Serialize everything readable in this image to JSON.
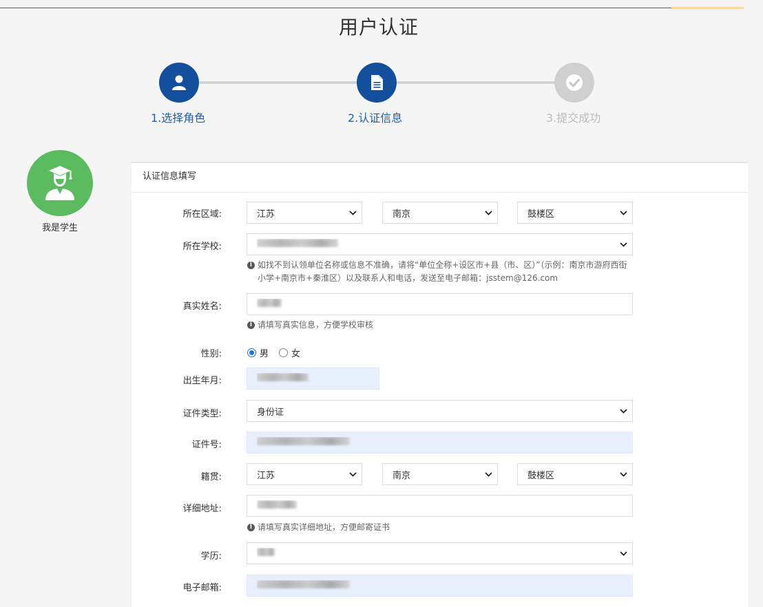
{
  "page": {
    "title": "用户认证"
  },
  "steps": [
    {
      "label": "1.选择角色",
      "icon": "user-icon",
      "state": "active"
    },
    {
      "label": "2.认证信息",
      "icon": "document-icon",
      "state": "active"
    },
    {
      "label": "3.提交成功",
      "icon": "check-icon",
      "state": "inactive"
    }
  ],
  "role": {
    "label": "我是学生",
    "icon": "graduate-icon"
  },
  "panel": {
    "title": "认证信息填写"
  },
  "form": {
    "region": {
      "label": "所在区域:",
      "province": "江苏",
      "city": "南京",
      "district": "鼓楼区"
    },
    "school": {
      "label": "所在学校:",
      "hint": "如找不到认领单位名称或信息不准确，请将“单位全称+设区市+县（市、区）”（示例：南京市游府西街小学+南京市+秦淮区）以及联系人和电话，发送至电子邮箱：jsstem@126.com"
    },
    "real_name": {
      "label": "真实姓名:",
      "hint": "请填写真实信息，方便学校审核"
    },
    "gender": {
      "label": "性别:",
      "options": [
        "男",
        "女"
      ],
      "selected": "男"
    },
    "birth": {
      "label": "出生年月:"
    },
    "id_type": {
      "label": "证件类型:",
      "value": "身份证"
    },
    "id_number": {
      "label": "证件号:"
    },
    "native_place": {
      "label": "籍贯:",
      "province": "江苏",
      "city": "南京",
      "district": "鼓楼区"
    },
    "address": {
      "label": "详细地址:",
      "hint": "请填写真实详细地址，方便邮寄证书"
    },
    "education": {
      "label": "学历:"
    },
    "email": {
      "label": "电子邮箱:"
    }
  },
  "colors": {
    "primary": "#134f9c",
    "inactive": "#d0d0d0",
    "role": "#5cba5f",
    "autofill": "#e8f0fe"
  }
}
